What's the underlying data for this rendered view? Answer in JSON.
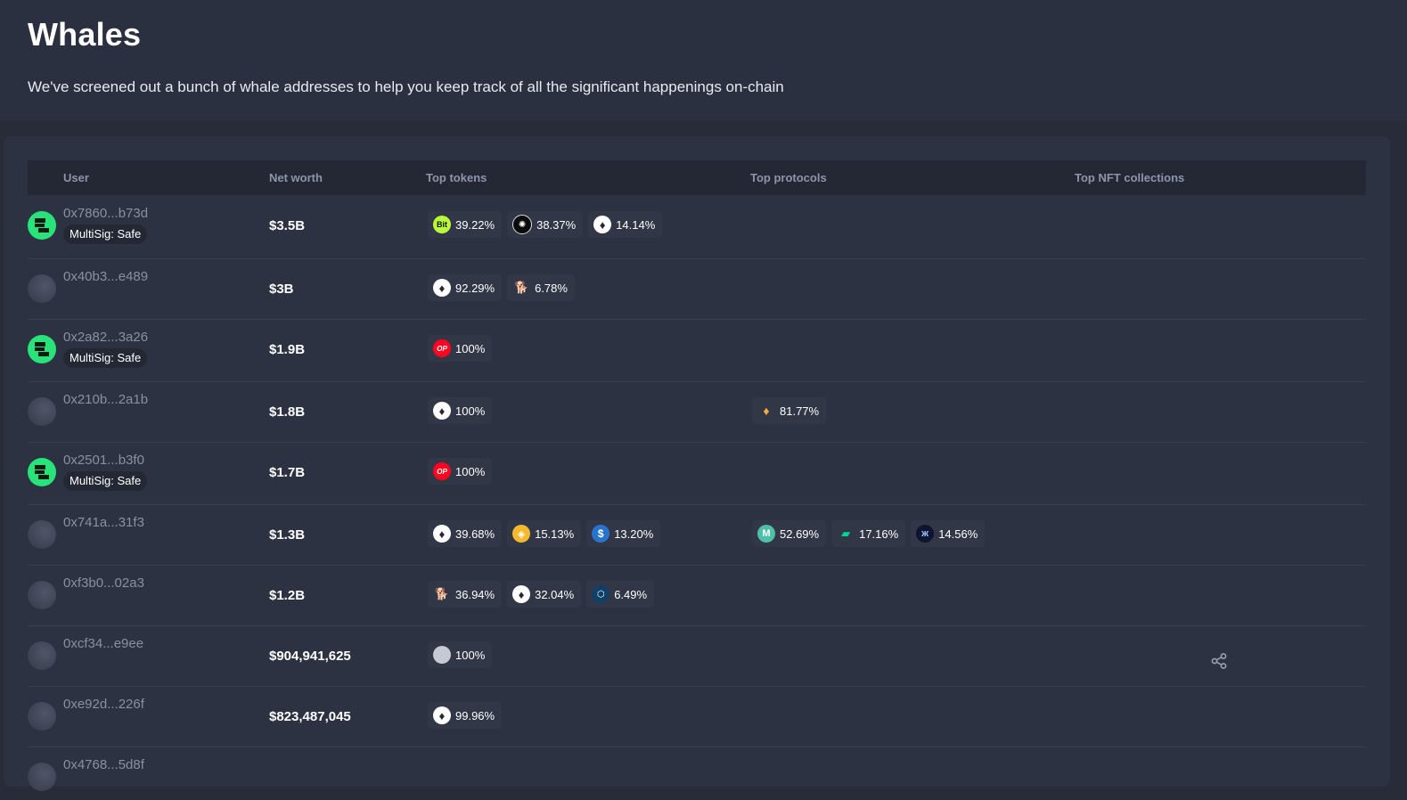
{
  "header": {
    "title": "Whales",
    "subtitle": "We've screened out a bunch of whale addresses to help you keep track of all the significant happenings on-chain"
  },
  "table": {
    "columns": {
      "user": "User",
      "net_worth": "Net worth",
      "top_tokens": "Top tokens",
      "top_protocols": "Top protocols",
      "top_nft": "Top NFT collections"
    },
    "rows": [
      {
        "address": "0x7860...b73d",
        "avatar": "safe-icon",
        "badge": "MultiSig: Safe",
        "net_worth": "$3.5B",
        "tokens": [
          {
            "icon": "bit-token-icon",
            "glyph": "Bit",
            "pct": "39.22%"
          },
          {
            "icon": "sunburst-token-icon",
            "glyph": "✺",
            "pct": "38.37%"
          },
          {
            "icon": "eth-icon",
            "glyph": "♦",
            "pct": "14.14%"
          }
        ],
        "protocols": []
      },
      {
        "address": "0x40b3...e489",
        "avatar": "default-avatar",
        "badge": "",
        "net_worth": "$3B",
        "tokens": [
          {
            "icon": "eth-icon",
            "glyph": "♦",
            "pct": "92.29%"
          },
          {
            "icon": "shib-icon",
            "glyph": "🐕",
            "pct": "6.78%"
          }
        ],
        "protocols": []
      },
      {
        "address": "0x2a82...3a26",
        "avatar": "safe-icon",
        "badge": "MultiSig: Safe",
        "net_worth": "$1.9B",
        "tokens": [
          {
            "icon": "op-icon",
            "glyph": "OP",
            "pct": "100%"
          }
        ],
        "protocols": []
      },
      {
        "address": "0x210b...2a1b",
        "avatar": "default-avatar",
        "badge": "",
        "net_worth": "$1.8B",
        "tokens": [
          {
            "icon": "eth-icon",
            "glyph": "♦",
            "pct": "100%"
          }
        ],
        "protocols": [
          {
            "icon": "lido-icon",
            "glyph": "♦",
            "pct": "81.77%"
          }
        ]
      },
      {
        "address": "0x2501...b3f0",
        "avatar": "safe-icon",
        "badge": "MultiSig: Safe",
        "net_worth": "$1.7B",
        "tokens": [
          {
            "icon": "op-icon",
            "glyph": "OP",
            "pct": "100%"
          }
        ],
        "protocols": []
      },
      {
        "address": "0x741a...31f3",
        "avatar": "default-avatar",
        "badge": "",
        "net_worth": "$1.3B",
        "tokens": [
          {
            "icon": "eth-icon",
            "glyph": "♦",
            "pct": "39.68%"
          },
          {
            "icon": "busd-icon",
            "glyph": "◈",
            "pct": "15.13%"
          },
          {
            "icon": "usdc-icon",
            "glyph": "$",
            "pct": "13.20%"
          }
        ],
        "protocols": [
          {
            "icon": "maker-icon",
            "glyph": "M",
            "pct": "52.69%"
          },
          {
            "icon": "compound-icon",
            "glyph": "▰",
            "pct": "17.16%"
          },
          {
            "icon": "morpho-icon",
            "glyph": "ж",
            "pct": "14.56%"
          }
        ]
      },
      {
        "address": "0xf3b0...02a3",
        "avatar": "default-avatar",
        "badge": "",
        "net_worth": "$1.2B",
        "tokens": [
          {
            "icon": "shib-icon",
            "glyph": "🐕",
            "pct": "36.94%"
          },
          {
            "icon": "eth-icon",
            "glyph": "♦",
            "pct": "32.04%"
          },
          {
            "icon": "cro-icon",
            "glyph": "⬡",
            "pct": "6.49%"
          }
        ],
        "protocols": []
      },
      {
        "address": "0xcf34...e9ee",
        "avatar": "default-avatar",
        "badge": "",
        "net_worth": "$904,941,625",
        "tokens": [
          {
            "icon": "gray-token-icon",
            "glyph": "●",
            "pct": "100%"
          }
        ],
        "protocols": []
      },
      {
        "address": "0xe92d...226f",
        "avatar": "default-avatar",
        "badge": "",
        "net_worth": "$823,487,045",
        "tokens": [
          {
            "icon": "eth-icon",
            "glyph": "♦",
            "pct": "99.96%"
          }
        ],
        "protocols": []
      },
      {
        "address": "0x4768...5d8f",
        "avatar": "default-avatar",
        "badge": "",
        "net_worth": "",
        "tokens": [],
        "protocols": []
      }
    ]
  },
  "share_icon": "share-icon"
}
